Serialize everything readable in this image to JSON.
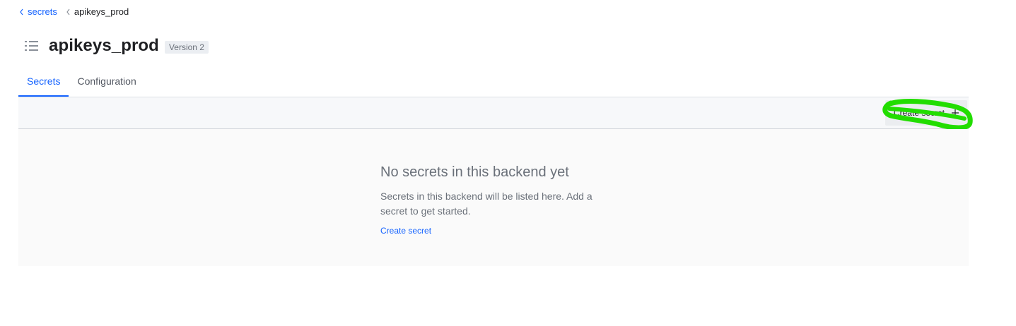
{
  "breadcrumb": {
    "parent_label": "secrets",
    "current_label": "apikeys_prod"
  },
  "header": {
    "icon": "list-icon",
    "title": "apikeys_prod",
    "version_badge": "Version 2"
  },
  "tabs": [
    {
      "label": "Secrets",
      "active": true
    },
    {
      "label": "Configuration",
      "active": false
    }
  ],
  "toolbar": {
    "create_button_label": "Create secret",
    "create_button_icon": "plus-icon",
    "highlight_color": "#22dd00"
  },
  "empty_state": {
    "title": "No secrets in this backend yet",
    "message": "Secrets in this backend will be listed here. Add a secret to get started.",
    "action_label": "Create secret"
  },
  "colors": {
    "accent": "#1563ff",
    "text": "#1f2023",
    "muted": "#6a7079"
  }
}
